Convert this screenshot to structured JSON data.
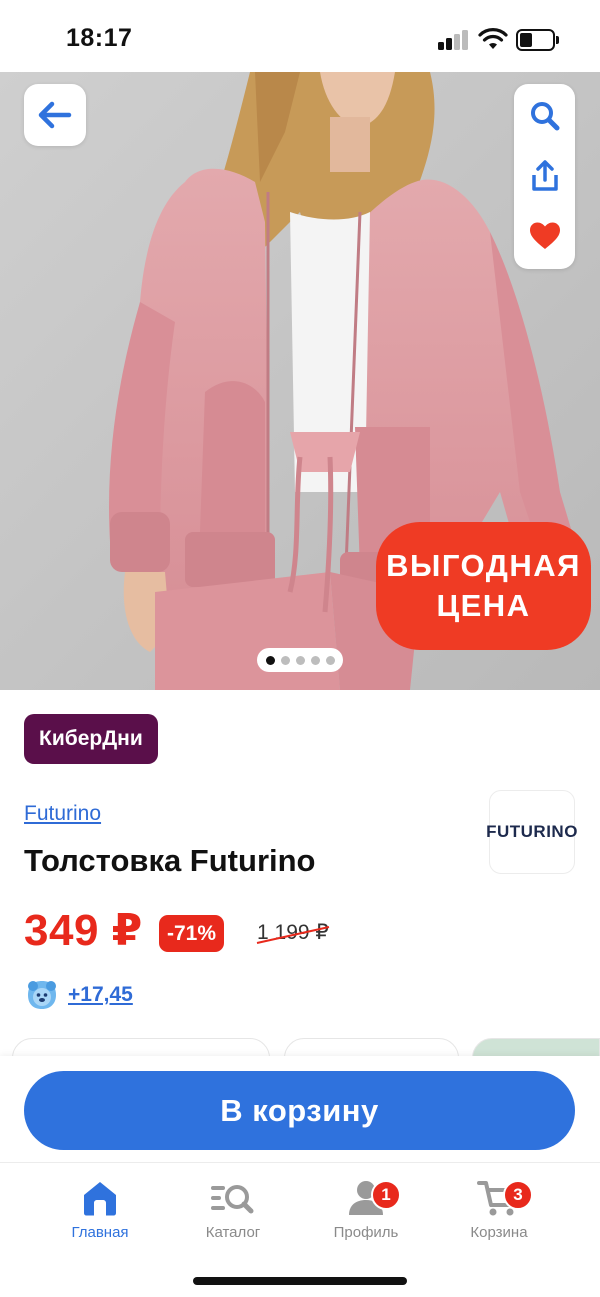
{
  "status_bar": {
    "time": "18:17"
  },
  "hero": {
    "promo_line1": "ВЫГОДНАЯ",
    "promo_line2": "ЦЕНА",
    "slides_count": 5,
    "active_slide": 1
  },
  "product": {
    "badge": "КиберДни",
    "brand": "Futurino",
    "brand_logo_text": "FUTURINO",
    "title": "Толстовка Futurino",
    "price": "349 ₽",
    "discount": "-71%",
    "old_price": "1 199 ₽",
    "bonus": "+17,45"
  },
  "cart_button": {
    "label": "В корзину"
  },
  "bottom_nav": {
    "items": [
      {
        "label": "Главная",
        "icon": "home-icon"
      },
      {
        "label": "Каталог",
        "icon": "catalog-search-icon"
      },
      {
        "label": "Профиль",
        "icon": "profile-icon",
        "badge": "1"
      },
      {
        "label": "Корзина",
        "icon": "cart-icon",
        "badge": "3"
      }
    ]
  },
  "colors": {
    "accent_blue": "#2f72dd",
    "sale_red": "#e8291c",
    "badge_purple": "#5a0f4a",
    "heart_red": "#ef3b24"
  }
}
